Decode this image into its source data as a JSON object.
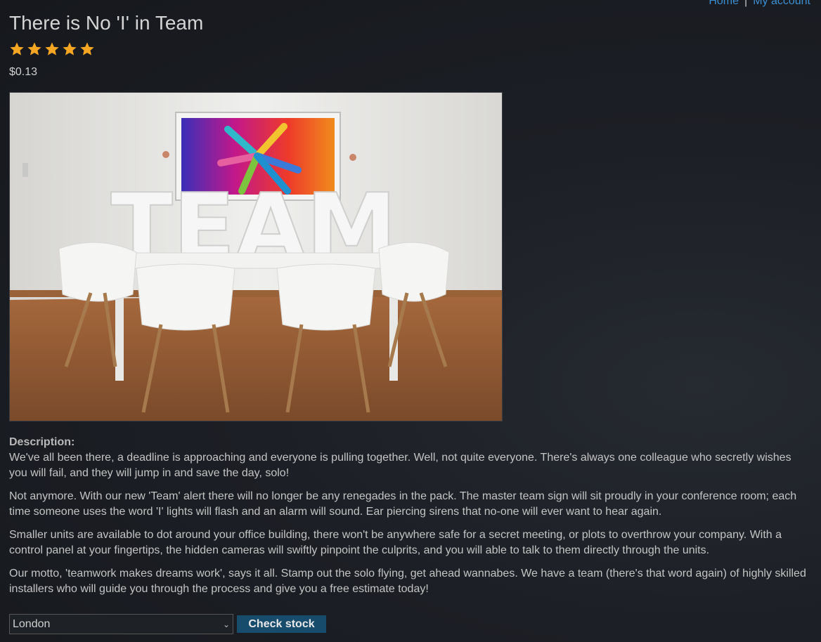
{
  "nav": {
    "home": "Home",
    "separator": "|",
    "account": "My account"
  },
  "product": {
    "title": "There is No 'I' in Team",
    "rating": 5,
    "rating_max": 5,
    "price": "$0.13",
    "image_text": "TEAM",
    "star_color": "#f5a623"
  },
  "description": {
    "label": "Description:",
    "paragraphs": [
      "We've all been there, a deadline is approaching and everyone is pulling together. Well, not quite everyone. There's always one colleague who secretly wishes you will fail, and they will jump in and save the day, solo!",
      "Not anymore. With our new 'Team' alert there will no longer be any renegades in the pack. The master team sign will sit proudly in your conference room; each time someone uses the word 'I' lights will flash and an alarm will sound. Ear piercing sirens that no-one will ever want to hear again.",
      "Smaller units are available to dot around your office building, there won't be anywhere safe for a secret meeting, or plots to overthrow your company. With a control panel at your fingertips, the hidden cameras will swiftly pinpoint the culprits, and you will able to talk to them directly through the units.",
      "Our motto, 'teamwork makes dreams work', says it all. Stamp out the solo flying, get ahead wannabes. We have a team (there's that word again) of highly skilled installers who will guide you through the process and give you a free estimate today!"
    ]
  },
  "stock": {
    "selected_store": "London",
    "button_label": "Check stock"
  },
  "colors": {
    "link": "#3c8fd3",
    "button_bg": "#184c6d"
  }
}
